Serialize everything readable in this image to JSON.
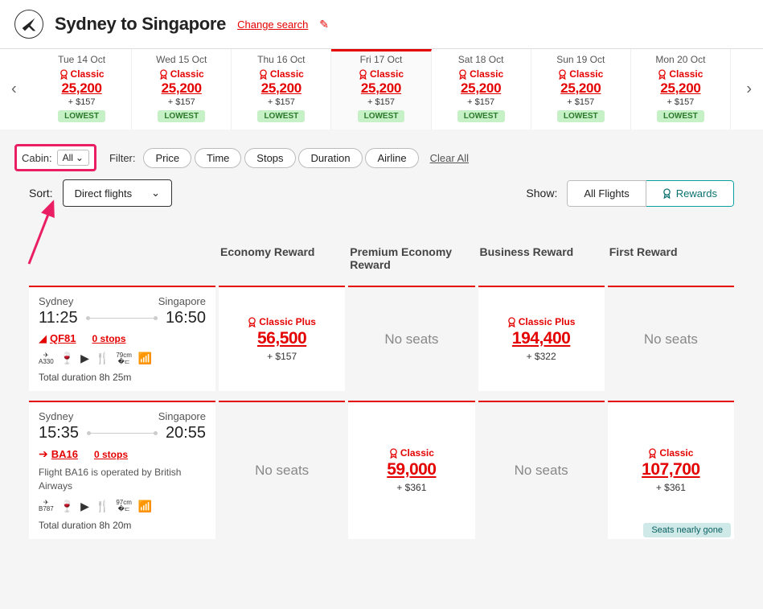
{
  "header": {
    "route": "Sydney to Singapore",
    "change_search": "Change search"
  },
  "date_strip": {
    "dates": [
      {
        "label": "Tue 14 Oct",
        "tier": "Classic",
        "points": "25,200",
        "cash": "+ $157",
        "lowest": "LOWEST",
        "selected": false
      },
      {
        "label": "Wed 15 Oct",
        "tier": "Classic",
        "points": "25,200",
        "cash": "+ $157",
        "lowest": "LOWEST",
        "selected": false
      },
      {
        "label": "Thu 16 Oct",
        "tier": "Classic",
        "points": "25,200",
        "cash": "+ $157",
        "lowest": "LOWEST",
        "selected": false
      },
      {
        "label": "Fri 17 Oct",
        "tier": "Classic",
        "points": "25,200",
        "cash": "+ $157",
        "lowest": "LOWEST",
        "selected": true
      },
      {
        "label": "Sat 18 Oct",
        "tier": "Classic",
        "points": "25,200",
        "cash": "+ $157",
        "lowest": "LOWEST",
        "selected": false
      },
      {
        "label": "Sun 19 Oct",
        "tier": "Classic",
        "points": "25,200",
        "cash": "+ $157",
        "lowest": "LOWEST",
        "selected": false
      },
      {
        "label": "Mon 20 Oct",
        "tier": "Classic",
        "points": "25,200",
        "cash": "+ $157",
        "lowest": "LOWEST",
        "selected": false
      }
    ]
  },
  "filters": {
    "cabin_label": "Cabin:",
    "cabin_value": "All",
    "filter_label": "Filter:",
    "chips": [
      "Price",
      "Time",
      "Stops",
      "Duration",
      "Airline"
    ],
    "clear_all": "Clear All"
  },
  "sort": {
    "label": "Sort:",
    "value": "Direct flights"
  },
  "show": {
    "label": "Show:",
    "all_flights": "All Flights",
    "rewards": "Rewards"
  },
  "columns": {
    "economy": "Economy Reward",
    "premium": "Premium Economy Reward",
    "business": "Business Reward",
    "first": "First Reward"
  },
  "no_seats": "No seats",
  "flights": [
    {
      "from_city": "Sydney",
      "to_city": "Singapore",
      "dep": "11:25",
      "arr": "16:50",
      "flight_no": "QF81",
      "stops": "0 stops",
      "airline": "QF",
      "note": "",
      "aircraft": "A330",
      "seat": "79cm",
      "duration": "Total duration 8h 25m",
      "fares": {
        "economy": {
          "tier": "Classic Plus",
          "points": "56,500",
          "cash": "+ $157",
          "available": true
        },
        "premium": {
          "available": false
        },
        "business": {
          "tier": "Classic Plus",
          "points": "194,400",
          "cash": "+ $322",
          "available": true
        },
        "first": {
          "available": false
        }
      }
    },
    {
      "from_city": "Sydney",
      "to_city": "Singapore",
      "dep": "15:35",
      "arr": "20:55",
      "flight_no": "BA16",
      "stops": "0 stops",
      "airline": "BA",
      "note": "Flight BA16 is operated by British Airways",
      "aircraft": "B787",
      "seat": "97cm",
      "duration": "Total duration 8h 20m",
      "fares": {
        "economy": {
          "available": false
        },
        "premium": {
          "tier": "Classic",
          "points": "59,000",
          "cash": "+ $361",
          "available": true
        },
        "business": {
          "available": false
        },
        "first": {
          "tier": "Classic",
          "points": "107,700",
          "cash": "+ $361",
          "available": true,
          "nearly_gone": "Seats nearly gone"
        }
      }
    }
  ]
}
